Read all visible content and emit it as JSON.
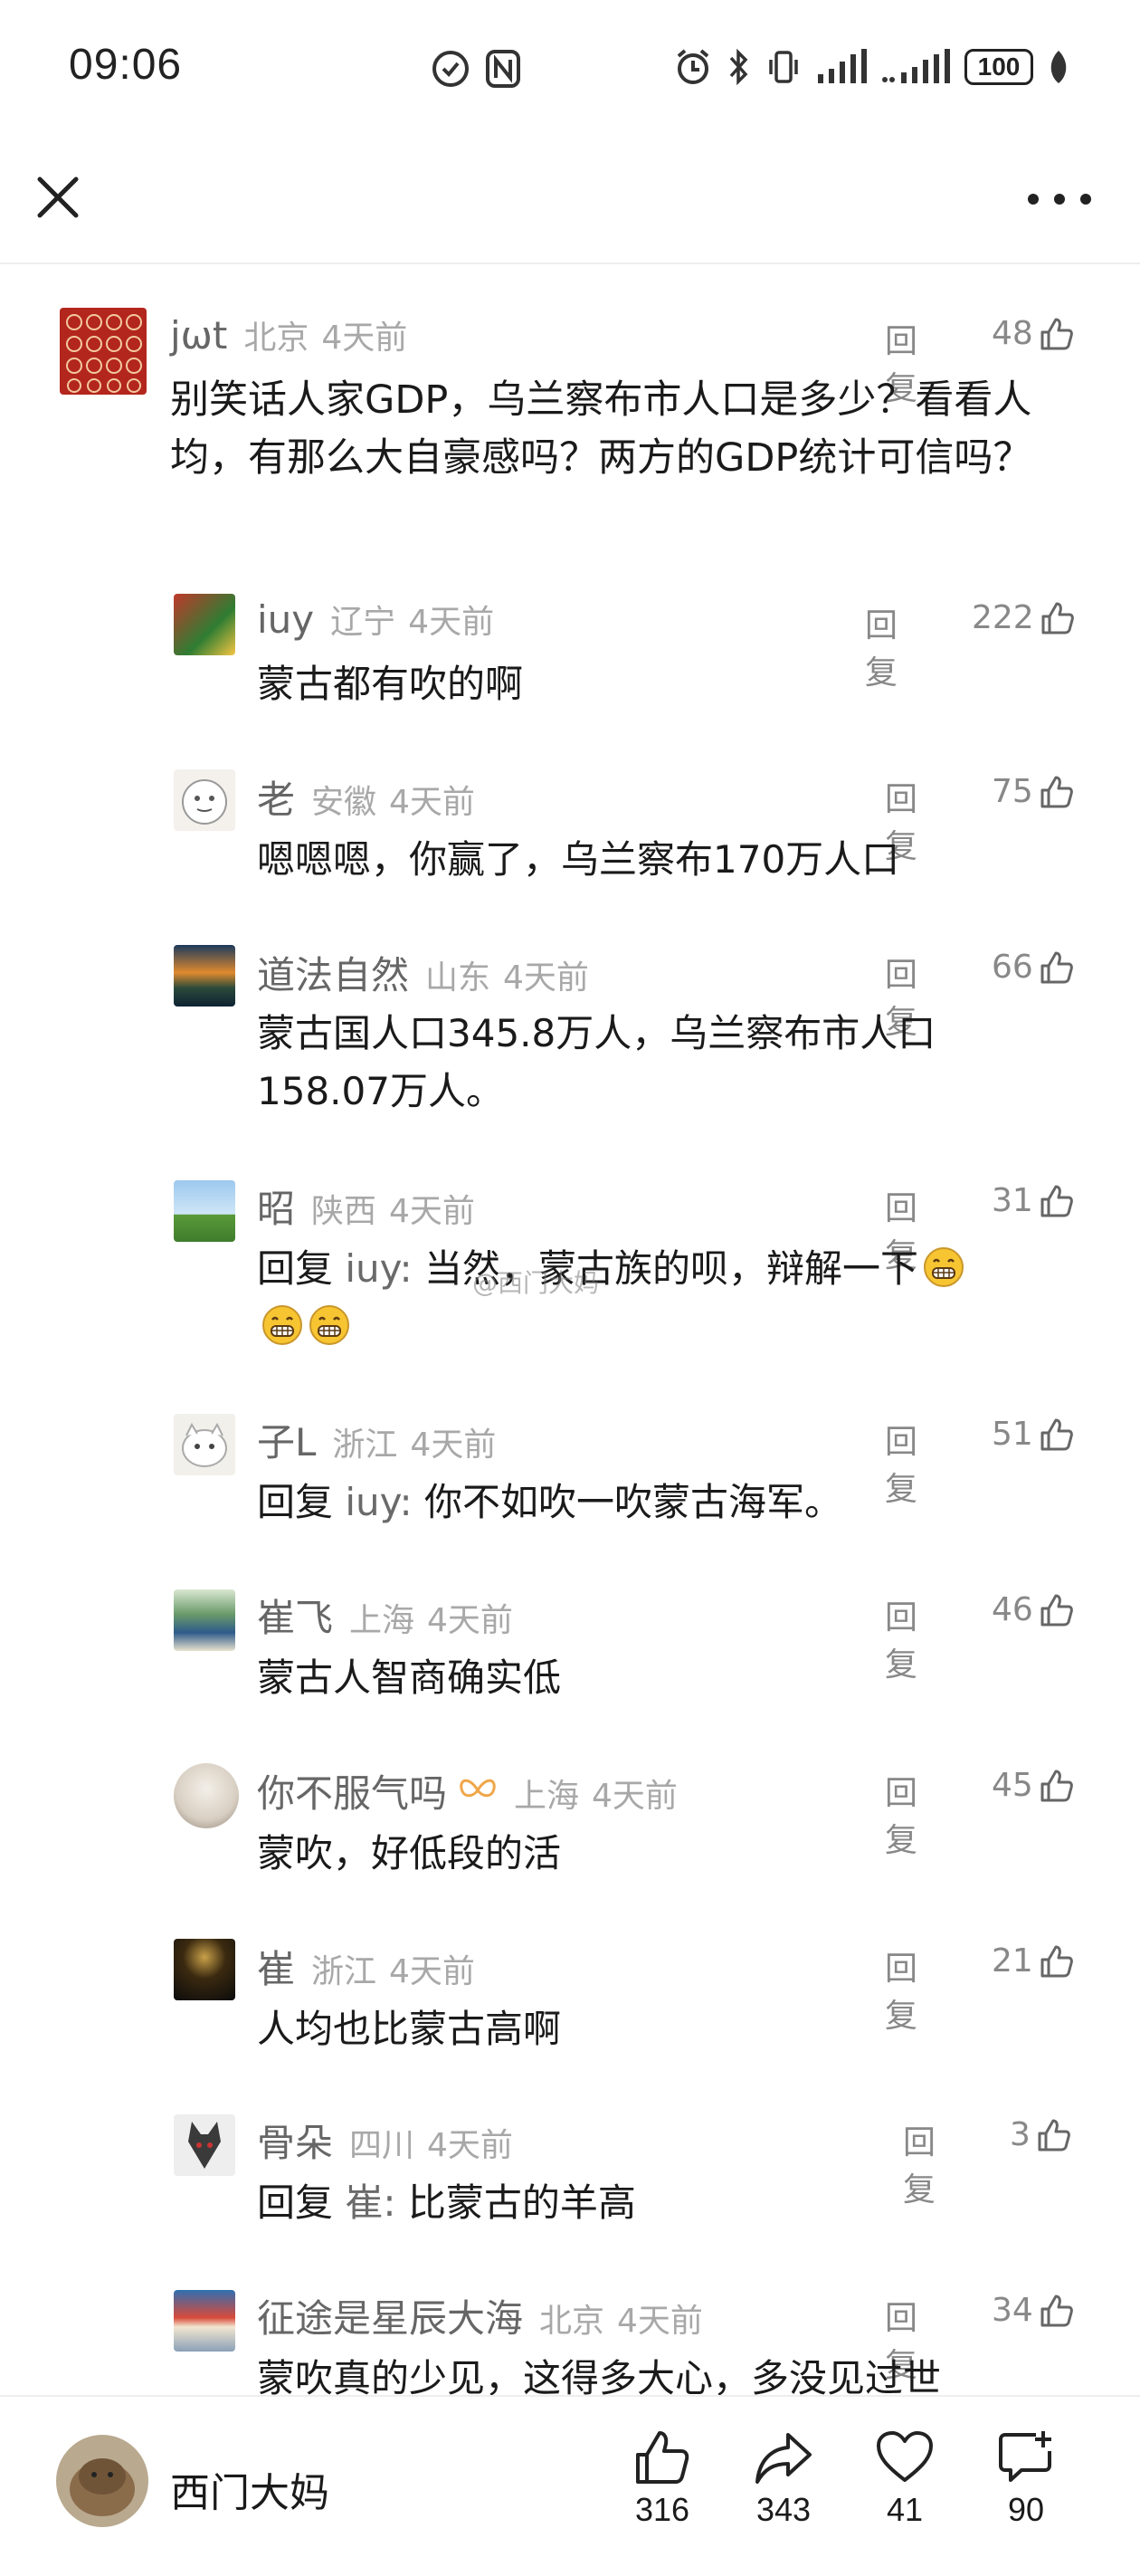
{
  "status_bar": {
    "time": "09:06",
    "battery": "100"
  },
  "watermark": "@西门大妈",
  "comments": [
    {
      "name": "jωt",
      "location": "北京",
      "time": "4天前",
      "reply_label": "回复",
      "likes": "48",
      "text": "别笑话人家GDP，乌兰察布市人口是多少？看看人均，有那么大自豪感吗？两方的GDP统计可信吗？"
    },
    {
      "name": "iuy",
      "location": "辽宁",
      "time": "4天前",
      "reply_label": "回复",
      "likes": "222",
      "text": "蒙古都有吹的啊"
    },
    {
      "name": "老",
      "location": "安徽",
      "time": "4天前",
      "reply_label": "回复",
      "likes": "75",
      "text": "嗯嗯嗯，你赢了，乌兰察布170万人口"
    },
    {
      "name": "道法自然",
      "location": "山东",
      "time": "4天前",
      "reply_label": "回复",
      "likes": "66",
      "text": "蒙古国人口345.8万人，乌兰察布市人口158.07万人。"
    },
    {
      "name": "昭",
      "location": "陕西",
      "time": "4天前",
      "reply_label": "回复",
      "likes": "31",
      "text_prefix": "回复 ",
      "text_mention": "iuy:",
      "text": " 当然，蒙古族的呗，辩解一下"
    },
    {
      "name": "子L",
      "location": "浙江",
      "time": "4天前",
      "reply_label": "回复",
      "likes": "51",
      "text_prefix": "回复 ",
      "text_mention": "iuy:",
      "text": " 你不如吹一吹蒙古海军。"
    },
    {
      "name": "崔飞",
      "location": "上海",
      "time": "4天前",
      "reply_label": "回复",
      "likes": "46",
      "text": "蒙古人智商确实低"
    },
    {
      "name": "你不服气吗",
      "location": "上海",
      "time": "4天前",
      "reply_label": "回复",
      "likes": "45",
      "text": "蒙吹，好低段的活"
    },
    {
      "name": "崔",
      "location": "浙江",
      "time": "4天前",
      "reply_label": "回复",
      "likes": "21",
      "text": "人均也比蒙古高啊"
    },
    {
      "name": "骨朵",
      "location": "四川",
      "time": "4天前",
      "reply_label": "回复",
      "likes": "3",
      "text_prefix": "回复 ",
      "text_mention": "崔:",
      "text": " 比蒙古的羊高"
    },
    {
      "name": "征途是星辰大海",
      "location": "北京",
      "time": "4天前",
      "reply_label": "回复",
      "likes": "34",
      "text": "蒙吹真的少见，这得多大心，多没见过世"
    }
  ],
  "bottom_bar": {
    "author": "西门大妈",
    "like_count": "316",
    "share_count": "343",
    "favorite_count": "41",
    "comment_count": "90"
  },
  "icons": [
    "close-icon",
    "more-icon",
    "like-icon",
    "share-icon",
    "heart-icon",
    "comment-add-icon",
    "grin-emoji"
  ]
}
